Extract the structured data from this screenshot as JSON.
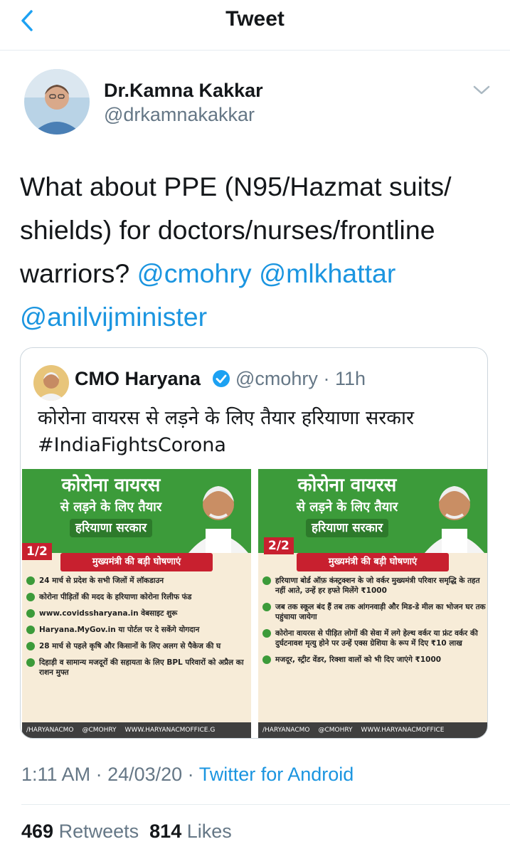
{
  "nav": {
    "title": "Tweet"
  },
  "author": {
    "name": "Dr.Kamna Kakkar",
    "handle": "@drkamnakakkar"
  },
  "tweet": {
    "text_before": "What about PPE (N95/Hazmat suits/ shields) for doctors/nurses/frontline warriors? ",
    "mentions": [
      "@cmohry",
      "@mlkhattar",
      "@anilvijminister"
    ]
  },
  "quoted": {
    "name": "CMO Haryana",
    "handle": "@cmohry",
    "separator": "·",
    "time": "11h",
    "text_line1": "कोरोना वायरस से लड़ने के लिए तैयार हरियाणा सरकार",
    "text_line2": "#IndiaFightsCorona"
  },
  "posters": [
    {
      "title1": "कोरोना वायरस",
      "title2": "से लड़ने के लिए तैयार",
      "title3": "हरियाणा सरकार",
      "page": "1/2",
      "subtitle": "मुख्यमंत्री की बड़ी घोषणाएं",
      "items": [
        "24 मार्च से प्रदेश के सभी जिलों में लॉकडाउन",
        "कोरोना पीड़ितों की मदद के हरियाणा कोरोना रिलीफ फंड",
        "www.covidssharyana.in वेबसाइट शुरू",
        "Haryana.MyGov.in या पोर्टल पर दे सकेंगे योगदान",
        "28 मार्च से पहले कृषि और किसानों के लिए अलग से पैकेज की घ",
        "दिहाड़ी व सामान्य मजदूरों की सहायता के लिए BPL परिवारों को अप्रैल का राशन मुफ्त"
      ],
      "footer": [
        "/HARYANACMO",
        "@CMOHRY",
        "WWW.HARYANACMOFFICE.G"
      ]
    },
    {
      "title1": "कोरोना वायरस",
      "title2": "से लड़ने के लिए तैयार",
      "title3": "हरियाणा सरकार",
      "page": "2/2",
      "subtitle": "मुख्यमंत्री की बड़ी घोषणाएं",
      "items": [
        "हरियाणा बोर्ड ऑफ़ कंस्ट्रक्शन के जो वर्कर मुख्यमंत्री परिवार समृद्धि के तहत नहीं आते, उन्हें हर हफ्ते मिलेंगे ₹1000",
        "जब तक स्कूल बंद हैं तब तक आंगनवाड़ी और मिड-डे मील का भोजन घर तक पहुंचाया जायेगा",
        "कोरोना वायरस से पीड़ित लोगों की सेवा में लगे हेल्थ वर्कर या फ्रंट वर्कर की दुर्घटनावश मृत्यु होने पर उन्हें एक्स ग्रेशिया के रूप में दिए ₹10 लाख",
        "मजदूर, स्ट्रीट वेंडर, रिक्शा वालों को भी दिए जाएंगे ₹1000"
      ],
      "footer": [
        "/HARYANACMO",
        "@CMOHRY",
        "WWW.HARYANACMOFFICE"
      ]
    }
  ],
  "timestamp": {
    "time": "1:11 AM",
    "sep": " · ",
    "date": "24/03/20",
    "sep2": " · ",
    "via": "Twitter for Android"
  },
  "stats": {
    "retweets_count": "469",
    "retweets_label": "Retweets",
    "likes_count": "814",
    "likes_label": "Likes"
  },
  "colors": {
    "link": "#1b95e0",
    "muted": "#657786",
    "poster_green": "#3c9b3a",
    "poster_red": "#c8202f"
  }
}
